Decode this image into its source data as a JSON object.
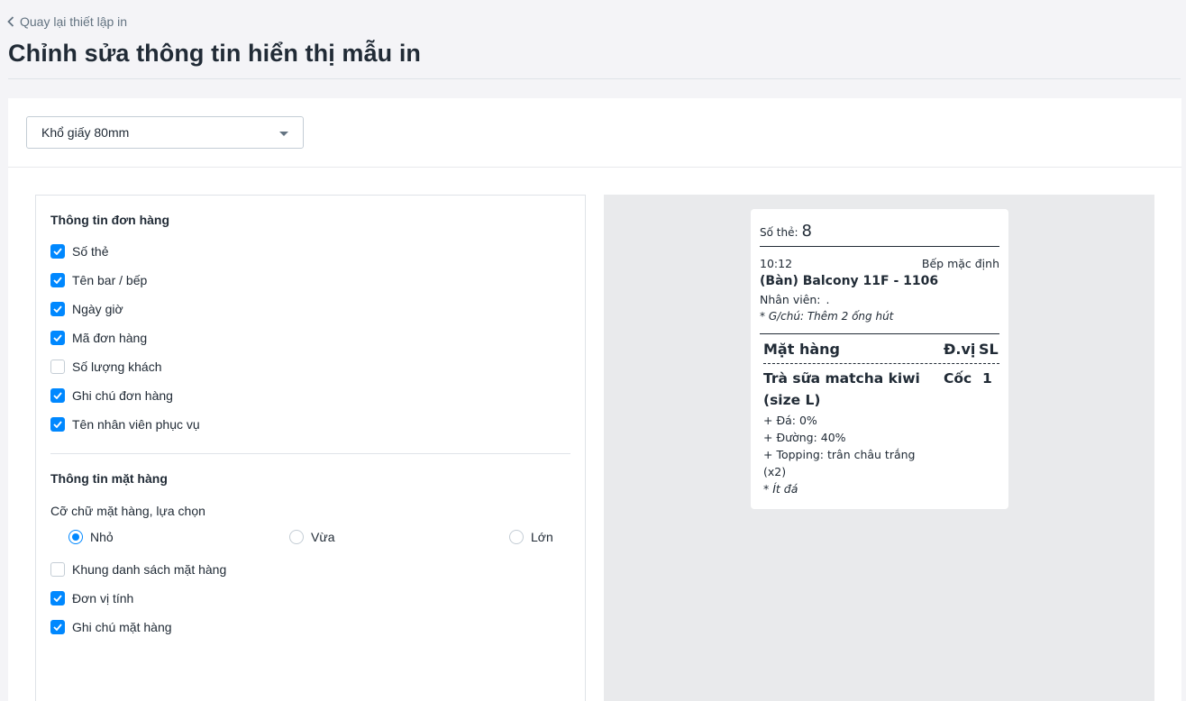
{
  "header": {
    "back_label": "Quay lại thiết lập in",
    "title": "Chỉnh sửa thông tin hiển thị mẫu in"
  },
  "paper_select": {
    "value": "Khổ giấy 80mm"
  },
  "order_info": {
    "title": "Thông tin đơn hàng",
    "items": [
      {
        "label": "Số thẻ",
        "checked": true
      },
      {
        "label": "Tên bar / bếp",
        "checked": true
      },
      {
        "label": "Ngày giờ",
        "checked": true
      },
      {
        "label": "Mã đơn hàng",
        "checked": true
      },
      {
        "label": "Số lượng khách",
        "checked": false
      },
      {
        "label": "Ghi chú đơn hàng",
        "checked": true
      },
      {
        "label": "Tên nhân viên phục vụ",
        "checked": true
      }
    ]
  },
  "item_info": {
    "title": "Thông tin mặt hàng",
    "font_size_label": "Cỡ chữ mặt hàng, lựa chọn",
    "font_sizes": [
      {
        "label": "Nhỏ",
        "selected": true
      },
      {
        "label": "Vừa",
        "selected": false
      },
      {
        "label": "Lớn",
        "selected": false
      }
    ],
    "items": [
      {
        "label": "Khung danh sách mặt hàng",
        "checked": false
      },
      {
        "label": "Đơn vị tính",
        "checked": true
      },
      {
        "label": "Ghi chú mặt hàng",
        "checked": true
      }
    ]
  },
  "receipt": {
    "card_label": "Số thẻ:",
    "card_number": "8",
    "time": "10:12",
    "kitchen": "Bếp mặc định",
    "table": "(Bàn) Balcony 11F - 1106",
    "staff_label": "Nhân viên:",
    "staff_name": ".",
    "order_note": "* G/chú: Thêm 2 ống hút",
    "col_item": "Mặt hàng",
    "col_unit": "Đ.vị",
    "col_qty": "SL",
    "item_name_line1": "Trà sữa matcha kiwi",
    "item_name_line2": "(size L)",
    "item_unit": "Cốc",
    "item_qty": "1",
    "options": [
      "+ Đá: 0%",
      "+ Đường: 40%",
      "+ Topping: trân châu trắng",
      "(x2)"
    ],
    "item_note": "* Ít đá"
  },
  "colors": {
    "accent": "#0088ff",
    "text": "#212b36",
    "muted": "#637381",
    "preview_bg": "#e9eaec"
  }
}
